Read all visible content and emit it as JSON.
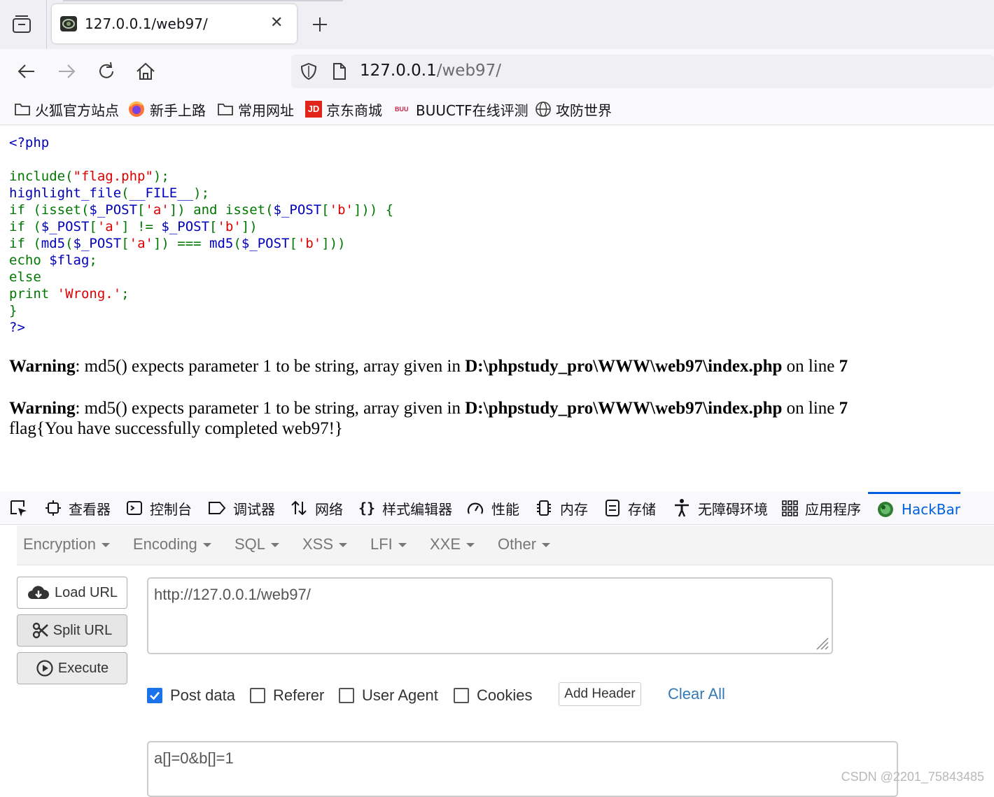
{
  "browser": {
    "tab": {
      "title": "127.0.0.1/web97/",
      "close": "✕"
    },
    "new_tab": "+",
    "url": {
      "host": "127.0.0.1",
      "path": "/web97/"
    },
    "bookmarks": [
      {
        "label": "火狐官方站点",
        "icon": "folder-icon"
      },
      {
        "label": "新手上路",
        "icon": "firefox-icon"
      },
      {
        "label": "常用网址",
        "icon": "folder-icon"
      },
      {
        "label": "京东商城",
        "icon": "jd-icon",
        "icon_text": "JD"
      },
      {
        "label": "BUUCTF在线评测",
        "icon": "buuctf-icon",
        "icon_text": "BUU"
      },
      {
        "label": "攻防世界",
        "icon": "globe-icon"
      }
    ]
  },
  "page": {
    "code": [
      [
        {
          "t": "<?php",
          "c": "df"
        }
      ],
      [],
      [
        {
          "t": "include(",
          "c": "kw"
        },
        {
          "t": "\"flag.php\"",
          "c": "st"
        },
        {
          "t": ");",
          "c": "kw"
        }
      ],
      [
        {
          "t": "highlight_file",
          "c": "df"
        },
        {
          "t": "(",
          "c": "kw"
        },
        {
          "t": "__FILE__",
          "c": "df"
        },
        {
          "t": ");",
          "c": "kw"
        }
      ],
      [
        {
          "t": "if (isset(",
          "c": "kw"
        },
        {
          "t": "$_POST",
          "c": "df"
        },
        {
          "t": "[",
          "c": "kw"
        },
        {
          "t": "'a'",
          "c": "st"
        },
        {
          "t": "]) and isset(",
          "c": "kw"
        },
        {
          "t": "$_POST",
          "c": "df"
        },
        {
          "t": "[",
          "c": "kw"
        },
        {
          "t": "'b'",
          "c": "st"
        },
        {
          "t": "])) {",
          "c": "kw"
        }
      ],
      [
        {
          "t": "if (",
          "c": "kw"
        },
        {
          "t": "$_POST",
          "c": "df"
        },
        {
          "t": "[",
          "c": "kw"
        },
        {
          "t": "'a'",
          "c": "st"
        },
        {
          "t": "] != ",
          "c": "kw"
        },
        {
          "t": "$_POST",
          "c": "df"
        },
        {
          "t": "[",
          "c": "kw"
        },
        {
          "t": "'b'",
          "c": "st"
        },
        {
          "t": "])",
          "c": "kw"
        }
      ],
      [
        {
          "t": "if (",
          "c": "kw"
        },
        {
          "t": "md5",
          "c": "df"
        },
        {
          "t": "(",
          "c": "kw"
        },
        {
          "t": "$_POST",
          "c": "df"
        },
        {
          "t": "[",
          "c": "kw"
        },
        {
          "t": "'a'",
          "c": "st"
        },
        {
          "t": "]) === ",
          "c": "kw"
        },
        {
          "t": "md5",
          "c": "df"
        },
        {
          "t": "(",
          "c": "kw"
        },
        {
          "t": "$_POST",
          "c": "df"
        },
        {
          "t": "[",
          "c": "kw"
        },
        {
          "t": "'b'",
          "c": "st"
        },
        {
          "t": "]))",
          "c": "kw"
        }
      ],
      [
        {
          "t": "echo ",
          "c": "kw"
        },
        {
          "t": "$flag",
          "c": "df"
        },
        {
          "t": ";",
          "c": "kw"
        }
      ],
      [
        {
          "t": "else",
          "c": "kw"
        }
      ],
      [
        {
          "t": "print ",
          "c": "kw"
        },
        {
          "t": "'Wrong.'",
          "c": "st"
        },
        {
          "t": ";",
          "c": "kw"
        }
      ],
      [
        {
          "t": "}",
          "c": "kw"
        }
      ],
      [
        {
          "t": "?>",
          "c": "df"
        }
      ]
    ],
    "warnings": [
      {
        "label": "Warning",
        "message": ": md5() expects parameter 1 to be string, array given in ",
        "file": "D:\\phpstudy_pro\\WWW\\web97\\index.php",
        "on_line": " on line ",
        "line": "7"
      },
      {
        "label": "Warning",
        "message": ": md5() expects parameter 1 to be string, array given in ",
        "file": "D:\\phpstudy_pro\\WWW\\web97\\index.php",
        "on_line": " on line ",
        "line": "7"
      }
    ],
    "flag": "flag{You have successfully completed web97!}"
  },
  "devtools": {
    "tabs": [
      {
        "label": "查看器",
        "icon": "inspector-icon"
      },
      {
        "label": "控制台",
        "icon": "console-icon"
      },
      {
        "label": "调试器",
        "icon": "debugger-icon"
      },
      {
        "label": "网络",
        "icon": "network-icon"
      },
      {
        "label": "样式编辑器",
        "icon": "style-editor-icon"
      },
      {
        "label": "性能",
        "icon": "performance-icon"
      },
      {
        "label": "内存",
        "icon": "memory-icon"
      },
      {
        "label": "存储",
        "icon": "storage-icon"
      },
      {
        "label": "无障碍环境",
        "icon": "accessibility-icon"
      },
      {
        "label": "应用程序",
        "icon": "application-icon"
      }
    ],
    "active_tab": "HackBar",
    "accent": "#0060df"
  },
  "hackbar": {
    "menu": [
      "Encryption",
      "Encoding",
      "SQL",
      "XSS",
      "LFI",
      "XXE",
      "Other"
    ],
    "buttons": {
      "load": "Load URL",
      "split": "Split URL",
      "execute": "Execute"
    },
    "url_value": "http://127.0.0.1/web97/",
    "options": [
      {
        "label": "Post data",
        "checked": true
      },
      {
        "label": "Referer",
        "checked": false
      },
      {
        "label": "User Agent",
        "checked": false
      },
      {
        "label": "Cookies",
        "checked": false
      }
    ],
    "add_header": "Add Header",
    "clear_all": "Clear All",
    "post_value": "a[]=0&b[]=1"
  },
  "watermark": "CSDN @2201_75843485"
}
